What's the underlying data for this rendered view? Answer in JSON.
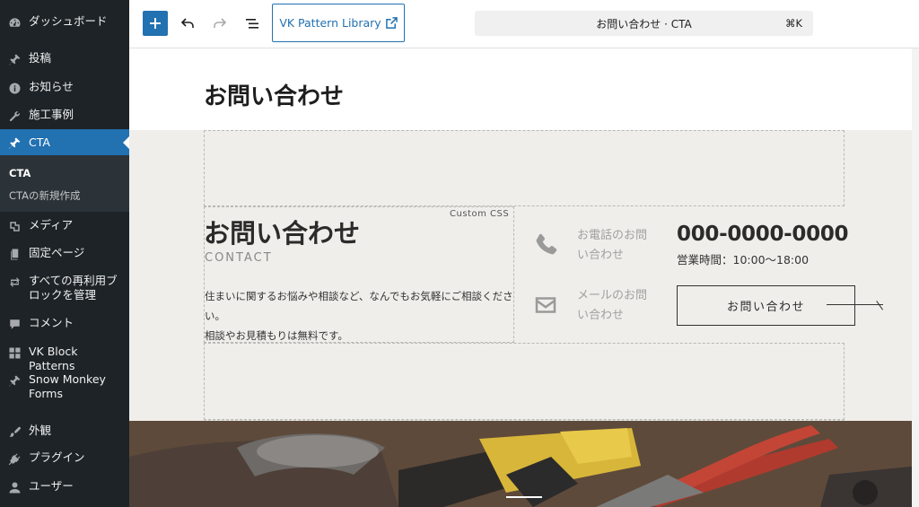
{
  "sidebar": {
    "items": [
      {
        "label": "ダッシュボード",
        "icon": "dashboard-icon"
      },
      {
        "label": "投稿",
        "icon": "pin-icon"
      },
      {
        "label": "お知らせ",
        "icon": "info-icon"
      },
      {
        "label": "施工事例",
        "icon": "wrench-icon"
      },
      {
        "label": "CTA",
        "icon": "pin-icon"
      },
      {
        "label": "メディア",
        "icon": "media-icon"
      },
      {
        "label": "固定ページ",
        "icon": "page-icon"
      },
      {
        "label": "すべての再利用ブロックを管理",
        "icon": "reusable-blocks-icon"
      },
      {
        "label": "コメント",
        "icon": "comment-icon"
      },
      {
        "label": "VK Block Patterns",
        "icon": "grid-icon"
      },
      {
        "label": "Snow Monkey Forms",
        "icon": "pin-icon"
      },
      {
        "label": "外観",
        "icon": "brush-icon"
      },
      {
        "label": "プラグイン",
        "icon": "plugin-icon"
      },
      {
        "label": "ユーザー",
        "icon": "user-icon"
      }
    ],
    "submenu": [
      {
        "label": "CTA"
      },
      {
        "label": "CTAの新規作成"
      }
    ]
  },
  "toolbar": {
    "add_icon": "plus-icon",
    "undo_icon": "undo-icon",
    "redo_icon": "redo-icon",
    "list_view_icon": "list-view-icon",
    "vk_library_label": "VK Pattern Library",
    "external_icon": "external-link-icon",
    "command_bar_title": "お問い合わせ · CTA",
    "command_shortcut": "⌘K"
  },
  "editor": {
    "page_title": "お問い合わせ",
    "cta": {
      "heading": "お問い合わせ",
      "subheading": "CONTACT",
      "description_line1": "住まいに関するお悩みや相談など、なんでもお気軽にご相談ください。",
      "description_line2": "相談やお見積もりは無料です。",
      "custom_css_label": "Custom CSS",
      "phone_label": "お電話のお問い合わせ",
      "phone_number": "000-0000-0000",
      "hours": "営業時間：10:00〜18:00",
      "mail_label": "メールのお問い合わせ",
      "button_label": "お問い合わせ"
    }
  },
  "colors": {
    "sidebar_bg": "#1d2327",
    "sidebar_active": "#2271b1",
    "accent": "#2271b1",
    "cta_bg": "#efeeea"
  }
}
